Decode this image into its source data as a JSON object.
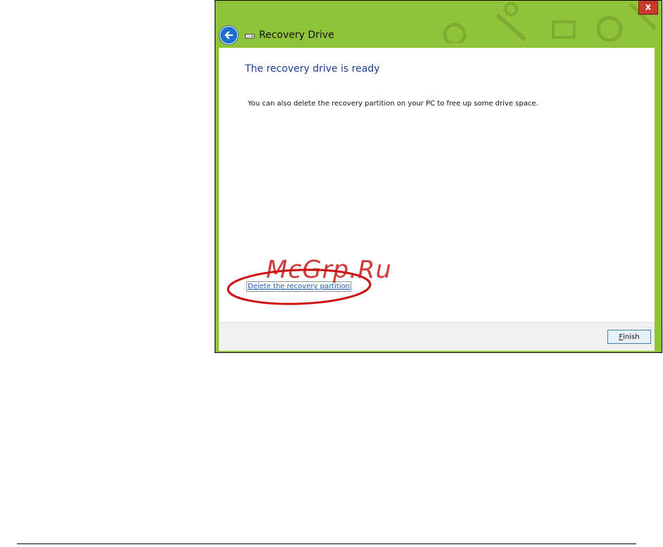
{
  "window": {
    "title": "Recovery Drive",
    "close_label": "x",
    "accent_color": "#8fc33a"
  },
  "nav": {
    "back_icon": "back-arrow-icon",
    "drive_icon": "drive-icon"
  },
  "content": {
    "heading": "The recovery drive is ready",
    "body": "You can also delete the recovery partition on your PC to free up some drive space.",
    "delete_link": "Delete the recovery partition"
  },
  "footer": {
    "finish_accel": "F",
    "finish_rest": "inish"
  },
  "overlay": {
    "watermark": "McGrp.Ru",
    "highlight_color": "#d01010"
  }
}
